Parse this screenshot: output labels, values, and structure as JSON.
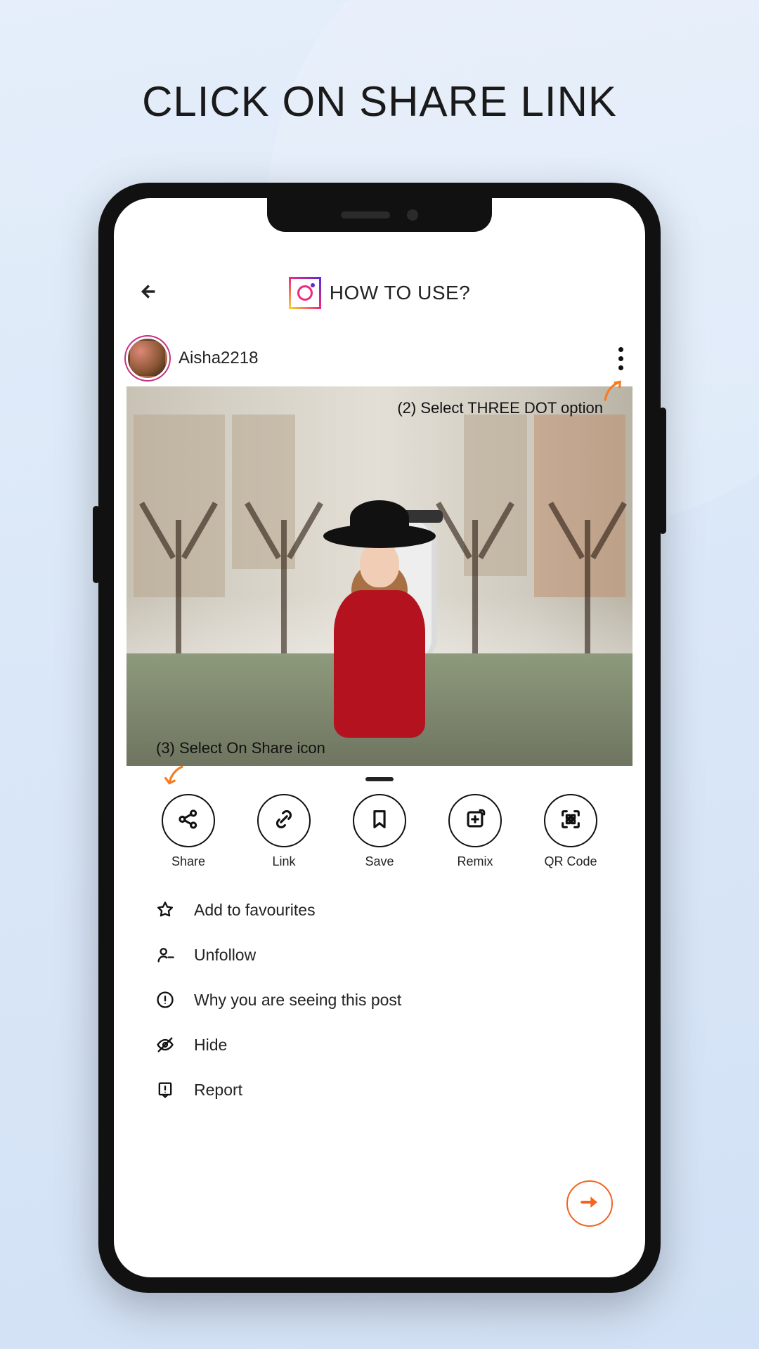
{
  "headline": "CLICK ON SHARE LINK",
  "topbar": {
    "title": "HOW TO USE?"
  },
  "post": {
    "username": "Aisha2218"
  },
  "annotations": {
    "step2": "(2) Select THREE DOT option",
    "step3": "(3) Select On Share icon"
  },
  "sheet": {
    "actions": {
      "share": "Share",
      "link": "Link",
      "save": "Save",
      "remix": "Remix",
      "qrcode": "QR Code"
    },
    "menu": {
      "favourites": "Add to favourites",
      "unfollow": "Unfollow",
      "why": "Why you are seeing this post",
      "hide": "Hide",
      "report": "Report"
    }
  },
  "colors": {
    "accent": "#f4641e"
  }
}
